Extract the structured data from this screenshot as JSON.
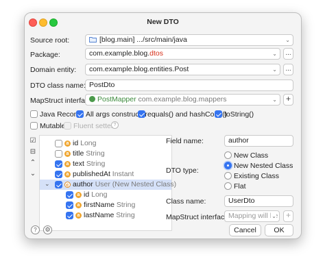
{
  "window": {
    "title": "New DTO"
  },
  "source_root": {
    "label": "Source root:",
    "value": "[blog.main] .../src/main/java"
  },
  "package": {
    "label": "Package:",
    "value_prefix": "com.example.blog.",
    "value_highlight": "dtos",
    "browse": "..."
  },
  "domain_entity": {
    "label": "Domain entity:",
    "value": "com.example.blog.entities.Post",
    "browse": "..."
  },
  "dto_class_name": {
    "label": "DTO class name:",
    "value": "PostDto"
  },
  "mapstruct": {
    "label": "MapStruct interface:",
    "mapper_name": "PostMapper",
    "mapper_package": "com.example.blog.mappers",
    "add": "+"
  },
  "options": {
    "java_record": {
      "label": "Java Record",
      "checked": false
    },
    "all_args": {
      "label": "All args constructor",
      "checked": true
    },
    "equals_hash": {
      "label": "equals() and hashCode()",
      "checked": true
    },
    "to_string": {
      "label": "toString()",
      "checked": true
    },
    "mutable": {
      "label": "Mutable",
      "checked": false
    },
    "fluent_setters": {
      "label": "Fluent setters",
      "checked": false
    },
    "help": "?"
  },
  "tree": {
    "rows": [
      {
        "name": "id",
        "type": "Long",
        "checked": false,
        "selected": false
      },
      {
        "name": "title",
        "type": "String",
        "checked": false,
        "selected": false
      },
      {
        "name": "text",
        "type": "String",
        "checked": true,
        "selected": false
      },
      {
        "name": "publishedAt",
        "type": "Instant",
        "checked": true,
        "selected": false
      },
      {
        "name": "author",
        "type": "User (New Nested Class)",
        "checked": true,
        "selected": true
      },
      {
        "name": "id",
        "type": "Long",
        "checked": true,
        "selected": false
      },
      {
        "name": "firstName",
        "type": "String",
        "checked": true,
        "selected": false
      },
      {
        "name": "lastName",
        "type": "String",
        "checked": true,
        "selected": false
      }
    ]
  },
  "details": {
    "field_name": {
      "label": "Field name:",
      "value": "author"
    },
    "dto_type": {
      "label": "DTO type:",
      "options": [
        "New Class",
        "New Nested Class",
        "Existing Class",
        "Flat"
      ],
      "selected": "New Nested Class"
    },
    "class_name": {
      "label": "Class name:",
      "value": "UserDto"
    },
    "mapstruct": {
      "label": "MapStruct interface:",
      "placeholder": "Mapping will be i",
      "add": "+"
    }
  },
  "footer": {
    "help": "?",
    "cancel": "Cancel",
    "ok": "OK"
  },
  "colors": {
    "accent": "#3574f0",
    "package_highlight": "#d6301a",
    "mapper_green": "#3c8a3c"
  }
}
